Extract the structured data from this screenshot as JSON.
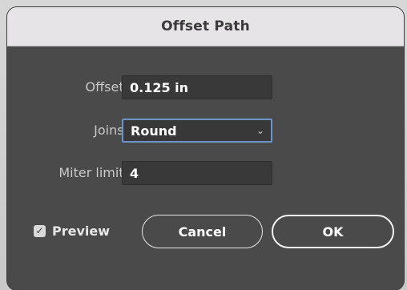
{
  "dialog": {
    "title": "Offset Path",
    "offset": {
      "label": "Offset:",
      "value": "0.125 in"
    },
    "joins": {
      "label": "Joins:",
      "selected": "Round"
    },
    "miter_limit": {
      "label": "Miter limit:",
      "value": "4"
    },
    "preview": {
      "label": "Preview",
      "checked": true
    },
    "buttons": {
      "cancel": "Cancel",
      "ok": "OK"
    }
  },
  "icons": {
    "checkbox": "checkmark-icon",
    "select": "chevron-down-icon"
  },
  "colors": {
    "dialog_bg": "#4a4a4a",
    "titlebar_bg": "#e7e4e7",
    "focus_ring": "#6b94c9"
  }
}
